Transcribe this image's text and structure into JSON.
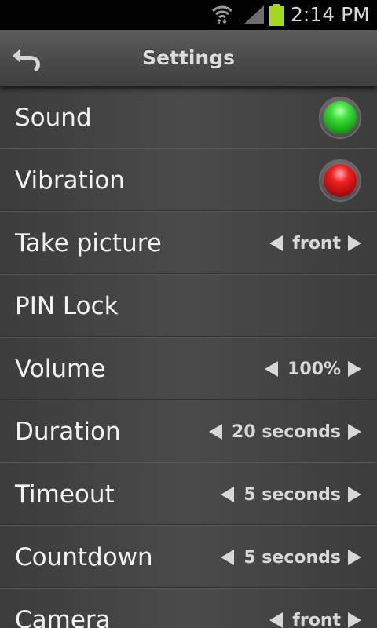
{
  "status_bar": {
    "time": "2:14 PM",
    "icons": [
      "wifi-icon",
      "signal-icon",
      "battery-icon"
    ],
    "battery_color": "#a4d81c"
  },
  "header": {
    "title": "Settings",
    "back_icon": "back-arrow-icon"
  },
  "colors": {
    "toggle_on": "#2ed32a",
    "toggle_off": "#e01818"
  },
  "settings": [
    {
      "label": "Sound",
      "type": "toggle",
      "state": "on"
    },
    {
      "label": "Vibration",
      "type": "toggle",
      "state": "off"
    },
    {
      "label": "Take picture",
      "type": "selector",
      "value": "front"
    },
    {
      "label": "PIN Lock",
      "type": "link"
    },
    {
      "label": "Volume",
      "type": "selector",
      "value": "100%"
    },
    {
      "label": "Duration",
      "type": "selector",
      "value": "20 seconds"
    },
    {
      "label": "Timeout",
      "type": "selector",
      "value": "5 seconds"
    },
    {
      "label": "Countdown",
      "type": "selector",
      "value": "5 seconds"
    },
    {
      "label": "Camera",
      "type": "selector",
      "value": "front"
    }
  ]
}
